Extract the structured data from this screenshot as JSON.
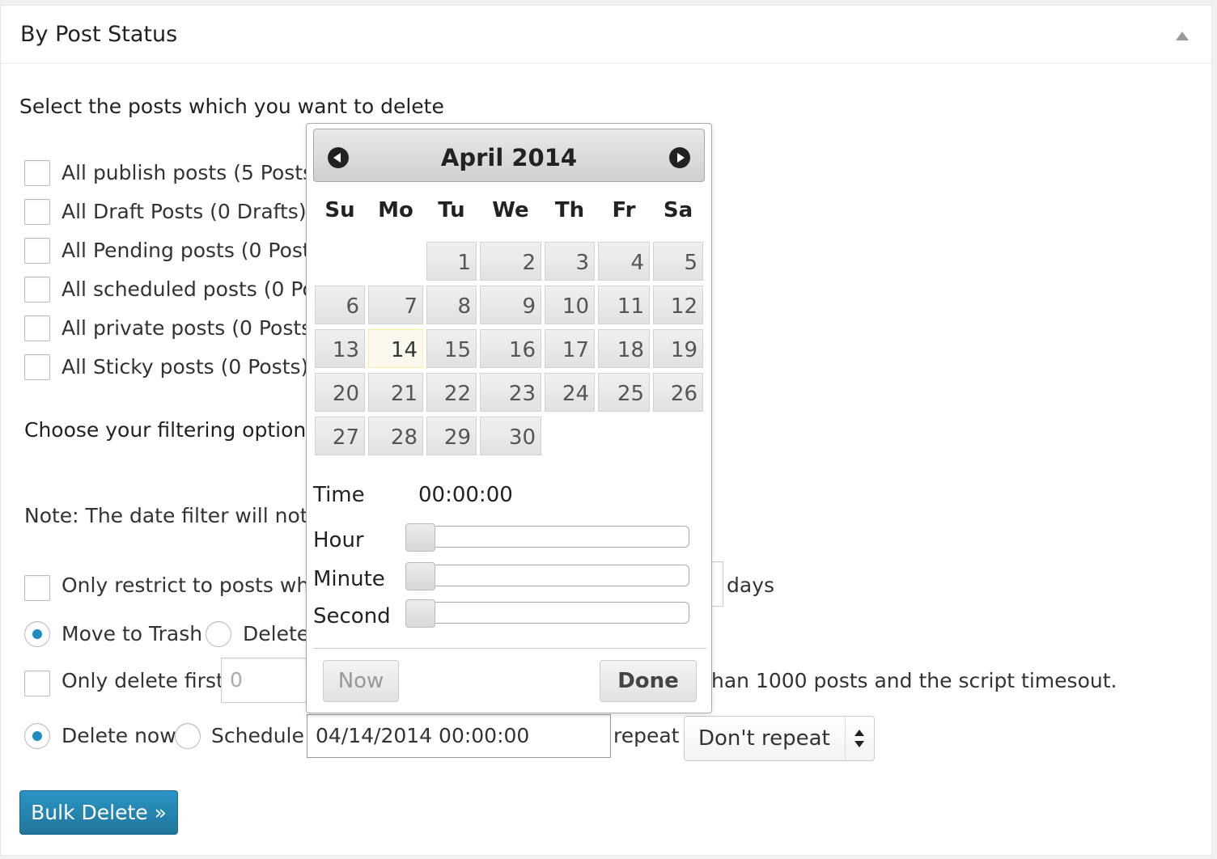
{
  "panel": {
    "title": "By Post Status"
  },
  "section": {
    "select_heading": "Select the posts which you want to delete",
    "filter_heading": "Choose your filtering option",
    "note": "Note: The date filter will not w"
  },
  "post_types": [
    {
      "label": "All publish posts (5 Posts)"
    },
    {
      "label": "All Draft Posts (0 Drafts)"
    },
    {
      "label": "All Pending posts (0 Posts"
    },
    {
      "label": "All scheduled posts (0 Pos"
    },
    {
      "label": "All private posts (0 Posts)"
    },
    {
      "label": "All Sticky posts (0 Posts)"
    }
  ],
  "restrict": {
    "label": "Only restrict to posts whic",
    "suffix": "days"
  },
  "delete_mode": {
    "trash_label": "Move to Trash",
    "delete_label": "Delete",
    "selected": "trash"
  },
  "limit": {
    "label": "Only delete first",
    "value": "0",
    "hint": "han 1000 posts and the script timesout."
  },
  "schedule": {
    "now_label": "Delete now",
    "schedule_label": "Schedule",
    "datetime_value": "04/14/2014 00:00:00",
    "repeat_label": "repeat",
    "repeat_selected": "Don't repeat"
  },
  "bulk_delete_label": "Bulk Delete »",
  "datepicker": {
    "month_title": "April 2014",
    "weekdays": [
      "Su",
      "Mo",
      "Tu",
      "We",
      "Th",
      "Fr",
      "Sa"
    ],
    "first_weekday_index": 2,
    "days_in_month": 30,
    "today": 14,
    "time_label": "Time",
    "time_value": "00:00:00",
    "hour_label": "Hour",
    "minute_label": "Minute",
    "second_label": "Second",
    "hour_value": 0,
    "minute_value": 0,
    "second_value": 0,
    "now_button": "Now",
    "done_button": "Done"
  },
  "colors": {
    "accent": "#21759b",
    "radio_selected": "#1e8cbe",
    "today_bg": "#fbf9ee"
  }
}
